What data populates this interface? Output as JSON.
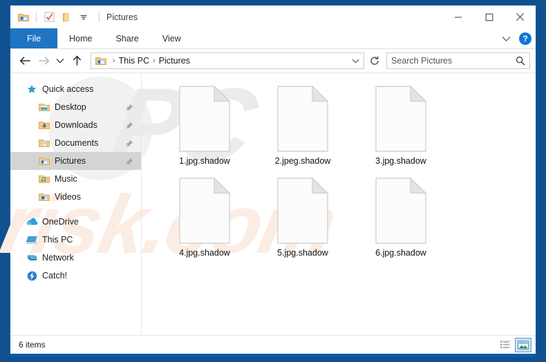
{
  "window": {
    "title": "Pictures",
    "quick_access_toolbar": [
      {
        "icon": "explorer-properties-icon",
        "name": "properties"
      },
      {
        "icon": "checkbox-icon",
        "name": "new-folder-options"
      },
      {
        "icon": "folder-icon",
        "name": "new-folder"
      },
      {
        "icon": "caret-down-icon",
        "name": "customize-quick-access-toolbar"
      }
    ],
    "controls": {
      "minimize": "minimize-icon",
      "maximize": "maximize-icon",
      "close": "close-icon"
    },
    "border_color": "#0a5ca8"
  },
  "ribbon": {
    "tabs": [
      {
        "label": "File",
        "active": true
      },
      {
        "label": "Home",
        "active": false
      },
      {
        "label": "Share",
        "active": false
      },
      {
        "label": "View",
        "active": false
      }
    ],
    "collapse_icon": "chevron-down-icon",
    "help_label": "?"
  },
  "address_bar": {
    "back_icon": "arrow-left-icon",
    "forward_icon": "arrow-right-icon",
    "recent_icon": "chevron-down-icon",
    "up_icon": "arrow-up-icon",
    "crumb_icon": "pictures-folder-icon",
    "breadcrumbs": [
      "This PC",
      "Pictures"
    ],
    "separator": "›",
    "dropdown_icon": "chevron-down-icon",
    "refresh_icon": "refresh-icon"
  },
  "search": {
    "placeholder": "Search Pictures",
    "value": "",
    "icon": "search-icon"
  },
  "sidebar": {
    "items": [
      {
        "label": "Quick access",
        "icon": "star-icon",
        "indent": false,
        "pinned": false,
        "selected": false
      },
      {
        "label": "Desktop",
        "icon": "desktop-folder-icon",
        "indent": true,
        "pinned": true,
        "selected": false
      },
      {
        "label": "Downloads",
        "icon": "downloads-folder-icon",
        "indent": true,
        "pinned": true,
        "selected": false
      },
      {
        "label": "Documents",
        "icon": "documents-folder-icon",
        "indent": true,
        "pinned": true,
        "selected": false
      },
      {
        "label": "Pictures",
        "icon": "pictures-folder-icon",
        "indent": true,
        "pinned": true,
        "selected": true
      },
      {
        "label": "Music",
        "icon": "music-folder-icon",
        "indent": true,
        "pinned": false,
        "selected": false
      },
      {
        "label": "Videos",
        "icon": "videos-folder-icon",
        "indent": true,
        "pinned": false,
        "selected": false
      },
      {
        "label": "OneDrive",
        "icon": "onedrive-cloud-icon",
        "indent": false,
        "pinned": false,
        "selected": false
      },
      {
        "label": "This PC",
        "icon": "this-pc-icon",
        "indent": false,
        "pinned": false,
        "selected": false
      },
      {
        "label": "Network",
        "icon": "network-icon",
        "indent": false,
        "pinned": false,
        "selected": false
      },
      {
        "label": "Catch!",
        "icon": "catch-app-icon",
        "indent": false,
        "pinned": false,
        "selected": false
      }
    ],
    "pin_icon": "pin-icon"
  },
  "files": {
    "items": [
      {
        "name": "1.jpg.shadow",
        "icon": "blank-document-icon"
      },
      {
        "name": "2.jpeg.shadow",
        "icon": "blank-document-icon"
      },
      {
        "name": "3.jpg.shadow",
        "icon": "blank-document-icon"
      },
      {
        "name": "4.jpg.shadow",
        "icon": "blank-document-icon"
      },
      {
        "name": "5.jpg.shadow",
        "icon": "blank-document-icon"
      },
      {
        "name": "6.jpg.shadow",
        "icon": "blank-document-icon"
      }
    ]
  },
  "status_bar": {
    "item_count_label": "6 items",
    "views": [
      {
        "name": "details-view",
        "active": false
      },
      {
        "name": "large-icons-view",
        "active": true
      }
    ]
  },
  "watermarks": {
    "top_text": "PC",
    "bottom_text": "risk.com"
  }
}
